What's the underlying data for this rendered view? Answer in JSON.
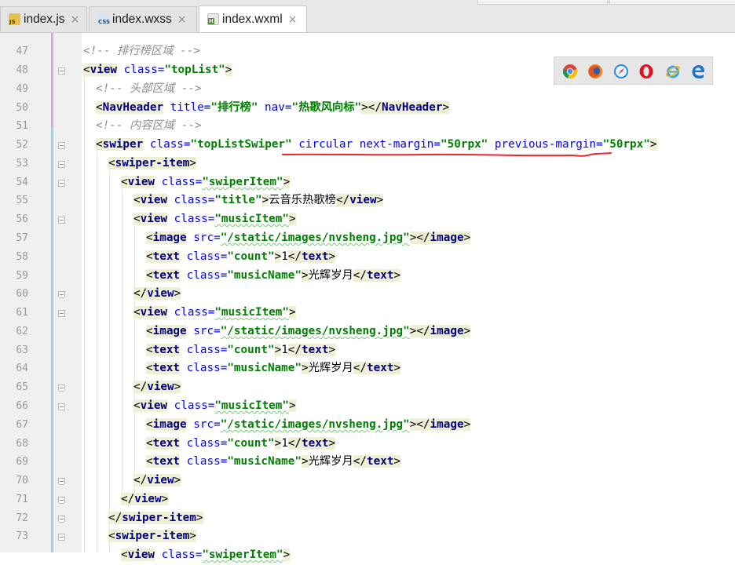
{
  "tabs": [
    {
      "name": "index.js",
      "icon": "js-file-icon",
      "icon_text": "JS",
      "active": false
    },
    {
      "name": "index.wxss",
      "icon": "css-file-icon",
      "icon_text": "CSS",
      "active": false
    },
    {
      "name": "index.wxml",
      "icon": "html-file-icon",
      "icon_text": "H",
      "active": true
    }
  ],
  "close_glyph": "×",
  "line_numbers": [
    "47",
    "48",
    "49",
    "50",
    "51",
    "52",
    "53",
    "54",
    "55",
    "56",
    "57",
    "58",
    "59",
    "60",
    "61",
    "62",
    "63",
    "64",
    "65",
    "66",
    "67",
    "68",
    "69",
    "70",
    "71",
    "72",
    "73"
  ],
  "code": {
    "l47": {
      "comment": "<!-- 排行榜区域 -->"
    },
    "l48": {
      "open": "<",
      "tag": "view",
      "attr": " class=",
      "val": "\"topList\"",
      "close": ">"
    },
    "l49": {
      "comment": "<!-- 头部区域 -->"
    },
    "l50": {
      "open": "<",
      "tag": "NavHeader",
      "attr1": " title=",
      "val1": "\"排行榜\"",
      "attr2": " nav=",
      "val2": "\"热歌风向标\"",
      "mid": "></",
      "tag2": "NavHeader",
      "close": ">"
    },
    "l51": {
      "comment": "<!-- 内容区域 -->"
    },
    "l52": {
      "open": "<",
      "tag": "swiper",
      "attr1": " class=",
      "val1": "\"topListSwiper\"",
      "attr2": " circular next-margin=",
      "val2": "\"50rpx\"",
      "attr3": " previous-margin=",
      "val3": "\"50rpx\"",
      "close": ">"
    },
    "l53": {
      "open": "<",
      "tag": "swiper-item",
      "close": ">"
    },
    "l54": {
      "open": "<",
      "tag": "view",
      "attr": " class=",
      "val": "\"swiperItem\"",
      "close": ">"
    },
    "l55": {
      "open": "<",
      "tag": "view",
      "attr": " class=",
      "val": "\"title\"",
      "mid": ">",
      "text": "云音乐热歌榜",
      "open2": "</",
      "tag2": "view",
      "close": ">"
    },
    "l56": {
      "open": "<",
      "tag": "view",
      "attr": " class=",
      "val": "\"musicItem\"",
      "close": ">"
    },
    "l57": {
      "open": "<",
      "tag": "image",
      "attr": " src=",
      "val": "\"/static/images/nvsheng.jpg\"",
      "mid": "></",
      "tag2": "image",
      "close": ">"
    },
    "l58": {
      "open": "<",
      "tag": "text",
      "attr": " class=",
      "val": "\"count\"",
      "mid": ">",
      "text": "1",
      "open2": "</",
      "tag2": "text",
      "close": ">"
    },
    "l59": {
      "open": "<",
      "tag": "text",
      "attr": " class=",
      "val": "\"musicName\"",
      "mid": ">",
      "text": "光辉岁月",
      "open2": "</",
      "tag2": "text",
      "close": ">"
    },
    "l60": {
      "open": "</",
      "tag": "view",
      "close": ">"
    },
    "l71": {
      "open": "</",
      "tag": "view",
      "close": ">"
    },
    "l72": {
      "open": "</",
      "tag": "swiper-item",
      "close": ">"
    },
    "l73": {
      "open": "<",
      "tag": "swiper-item",
      "close": ">"
    },
    "l74": {
      "open": "<",
      "tag": "view",
      "attr": " class=",
      "val": "\"swiperItem\"",
      "close": ">"
    }
  },
  "browsers": [
    "chrome-icon",
    "firefox-icon",
    "safari-icon",
    "opera-icon",
    "ie-icon",
    "edge-icon"
  ],
  "colors": {
    "tag": "#000080",
    "attribute": "#0000ff",
    "value": "#008000",
    "comment": "#8c8c8c",
    "gutter": "#f0f0f0",
    "annotation": "#e8262b"
  }
}
